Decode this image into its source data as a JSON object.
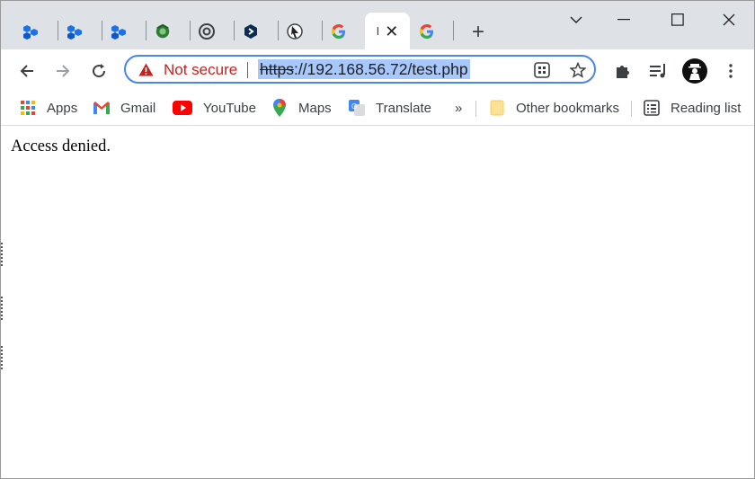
{
  "tabs": [
    {
      "favicon": "hex-blue-icon",
      "active": false
    },
    {
      "favicon": "hex-blue-icon",
      "active": false
    },
    {
      "favicon": "hex-blue-icon",
      "active": false
    },
    {
      "favicon": "green-recycle-icon",
      "active": false
    },
    {
      "favicon": "chrome-icon",
      "active": false
    },
    {
      "favicon": "shield-dark-icon",
      "active": false
    },
    {
      "favicon": "cursor-icon",
      "active": false
    },
    {
      "favicon": "google-icon",
      "active": false
    },
    {
      "favicon": "",
      "title": "I",
      "active": true
    },
    {
      "favicon": "google-icon",
      "active": false
    }
  ],
  "omnibox": {
    "security_label": "Not secure",
    "url_scheme": "https",
    "url_rest": "://192.168.56.72/test.php"
  },
  "bookmarks": {
    "items": [
      {
        "label": "Apps",
        "icon": "apps-grid-icon"
      },
      {
        "label": "Gmail",
        "icon": "gmail-icon"
      },
      {
        "label": "YouTube",
        "icon": "youtube-icon"
      },
      {
        "label": "Maps",
        "icon": "maps-pin-icon"
      },
      {
        "label": "Translate",
        "icon": "translate-icon"
      }
    ],
    "overflow_label": "»",
    "other_bookmarks": "Other bookmarks",
    "reading_list": "Reading list"
  },
  "page": {
    "message": "Access denied."
  },
  "colors": {
    "tabstrip_bg": "#dee1e6",
    "omnibox_border": "#4a86e8",
    "not_secure": "#c5221f",
    "url_highlight": "#a8c7fa"
  }
}
